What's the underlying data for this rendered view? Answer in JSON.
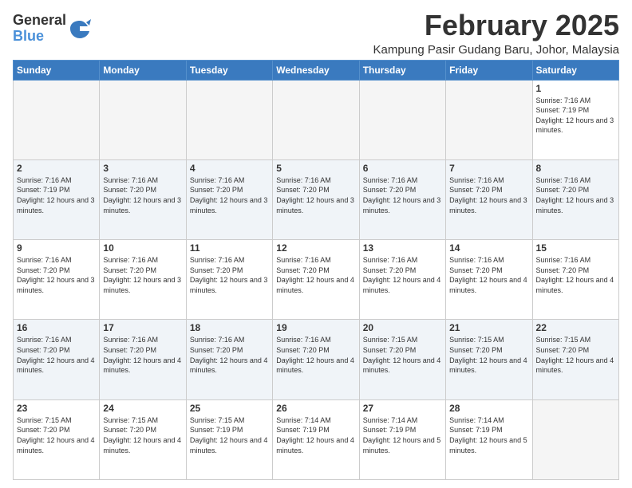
{
  "logo": {
    "general": "General",
    "blue": "Blue"
  },
  "title": "February 2025",
  "subtitle": "Kampung Pasir Gudang Baru, Johor, Malaysia",
  "weekdays": [
    "Sunday",
    "Monday",
    "Tuesday",
    "Wednesday",
    "Thursday",
    "Friday",
    "Saturday"
  ],
  "weeks": [
    [
      {
        "day": "",
        "empty": true
      },
      {
        "day": "",
        "empty": true
      },
      {
        "day": "",
        "empty": true
      },
      {
        "day": "",
        "empty": true
      },
      {
        "day": "",
        "empty": true
      },
      {
        "day": "",
        "empty": true
      },
      {
        "day": "1",
        "sunrise": "7:16 AM",
        "sunset": "7:19 PM",
        "daylight": "12 hours and 3 minutes."
      }
    ],
    [
      {
        "day": "2",
        "sunrise": "7:16 AM",
        "sunset": "7:19 PM",
        "daylight": "12 hours and 3 minutes."
      },
      {
        "day": "3",
        "sunrise": "7:16 AM",
        "sunset": "7:20 PM",
        "daylight": "12 hours and 3 minutes."
      },
      {
        "day": "4",
        "sunrise": "7:16 AM",
        "sunset": "7:20 PM",
        "daylight": "12 hours and 3 minutes."
      },
      {
        "day": "5",
        "sunrise": "7:16 AM",
        "sunset": "7:20 PM",
        "daylight": "12 hours and 3 minutes."
      },
      {
        "day": "6",
        "sunrise": "7:16 AM",
        "sunset": "7:20 PM",
        "daylight": "12 hours and 3 minutes."
      },
      {
        "day": "7",
        "sunrise": "7:16 AM",
        "sunset": "7:20 PM",
        "daylight": "12 hours and 3 minutes."
      },
      {
        "day": "8",
        "sunrise": "7:16 AM",
        "sunset": "7:20 PM",
        "daylight": "12 hours and 3 minutes."
      }
    ],
    [
      {
        "day": "9",
        "sunrise": "7:16 AM",
        "sunset": "7:20 PM",
        "daylight": "12 hours and 3 minutes."
      },
      {
        "day": "10",
        "sunrise": "7:16 AM",
        "sunset": "7:20 PM",
        "daylight": "12 hours and 3 minutes."
      },
      {
        "day": "11",
        "sunrise": "7:16 AM",
        "sunset": "7:20 PM",
        "daylight": "12 hours and 3 minutes."
      },
      {
        "day": "12",
        "sunrise": "7:16 AM",
        "sunset": "7:20 PM",
        "daylight": "12 hours and 4 minutes."
      },
      {
        "day": "13",
        "sunrise": "7:16 AM",
        "sunset": "7:20 PM",
        "daylight": "12 hours and 4 minutes."
      },
      {
        "day": "14",
        "sunrise": "7:16 AM",
        "sunset": "7:20 PM",
        "daylight": "12 hours and 4 minutes."
      },
      {
        "day": "15",
        "sunrise": "7:16 AM",
        "sunset": "7:20 PM",
        "daylight": "12 hours and 4 minutes."
      }
    ],
    [
      {
        "day": "16",
        "sunrise": "7:16 AM",
        "sunset": "7:20 PM",
        "daylight": "12 hours and 4 minutes."
      },
      {
        "day": "17",
        "sunrise": "7:16 AM",
        "sunset": "7:20 PM",
        "daylight": "12 hours and 4 minutes."
      },
      {
        "day": "18",
        "sunrise": "7:16 AM",
        "sunset": "7:20 PM",
        "daylight": "12 hours and 4 minutes."
      },
      {
        "day": "19",
        "sunrise": "7:16 AM",
        "sunset": "7:20 PM",
        "daylight": "12 hours and 4 minutes."
      },
      {
        "day": "20",
        "sunrise": "7:15 AM",
        "sunset": "7:20 PM",
        "daylight": "12 hours and 4 minutes."
      },
      {
        "day": "21",
        "sunrise": "7:15 AM",
        "sunset": "7:20 PM",
        "daylight": "12 hours and 4 minutes."
      },
      {
        "day": "22",
        "sunrise": "7:15 AM",
        "sunset": "7:20 PM",
        "daylight": "12 hours and 4 minutes."
      }
    ],
    [
      {
        "day": "23",
        "sunrise": "7:15 AM",
        "sunset": "7:20 PM",
        "daylight": "12 hours and 4 minutes."
      },
      {
        "day": "24",
        "sunrise": "7:15 AM",
        "sunset": "7:20 PM",
        "daylight": "12 hours and 4 minutes."
      },
      {
        "day": "25",
        "sunrise": "7:15 AM",
        "sunset": "7:19 PM",
        "daylight": "12 hours and 4 minutes."
      },
      {
        "day": "26",
        "sunrise": "7:14 AM",
        "sunset": "7:19 PM",
        "daylight": "12 hours and 4 minutes."
      },
      {
        "day": "27",
        "sunrise": "7:14 AM",
        "sunset": "7:19 PM",
        "daylight": "12 hours and 5 minutes."
      },
      {
        "day": "28",
        "sunrise": "7:14 AM",
        "sunset": "7:19 PM",
        "daylight": "12 hours and 5 minutes."
      },
      {
        "day": "",
        "empty": true
      }
    ]
  ]
}
